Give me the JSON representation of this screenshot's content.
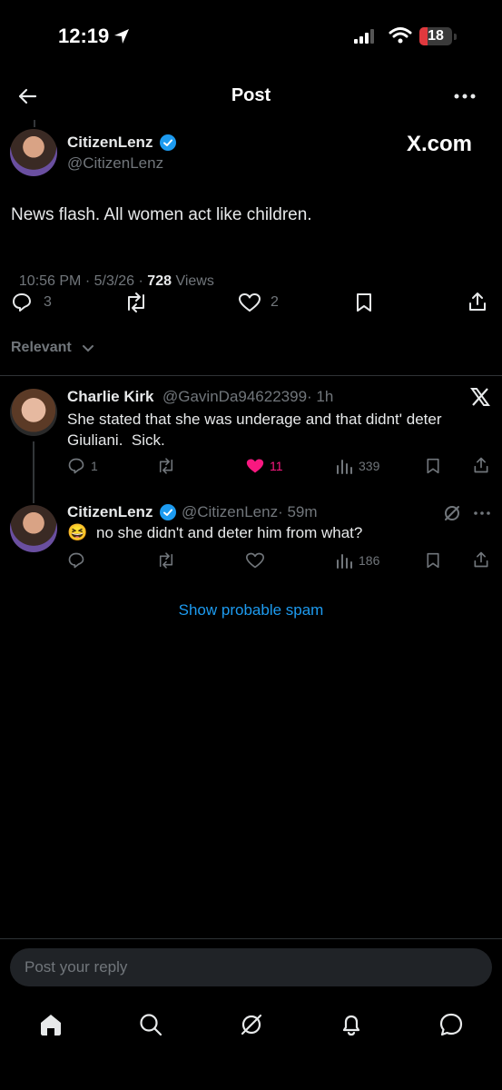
{
  "status_bar": {
    "time": "12:19",
    "battery": "18"
  },
  "header": {
    "title": "Post"
  },
  "post": {
    "display_name": "CitizenLenz",
    "handle": "@CitizenLenz",
    "watermark": "X.com",
    "text": "News flash. All women act like children.",
    "timestamp": "10:56 PM · 5/3/26 · ",
    "views_count": "728",
    "views_label": " Views",
    "replies": "3",
    "likes": "2"
  },
  "sort": {
    "label": "Relevant"
  },
  "replies": [
    {
      "display_name": "Charlie Kirk",
      "handle": "@GavinDa94622399",
      "time": "· 1h",
      "text": "She stated that she was underage and that didnt' deter Giuliani.  Sick.",
      "replies": "1",
      "likes": "11",
      "views": "339",
      "like_color": "#f91880"
    },
    {
      "display_name": "CitizenLenz",
      "handle": "@CitizenLenz",
      "time": "· 59m",
      "emoji": "😆",
      "text": "no she didn't and deter him from what?",
      "views": "186"
    }
  ],
  "spam_link": "Show probable spam",
  "composer": {
    "placeholder": "Post your reply"
  },
  "accent_color": "#1d9bf0"
}
